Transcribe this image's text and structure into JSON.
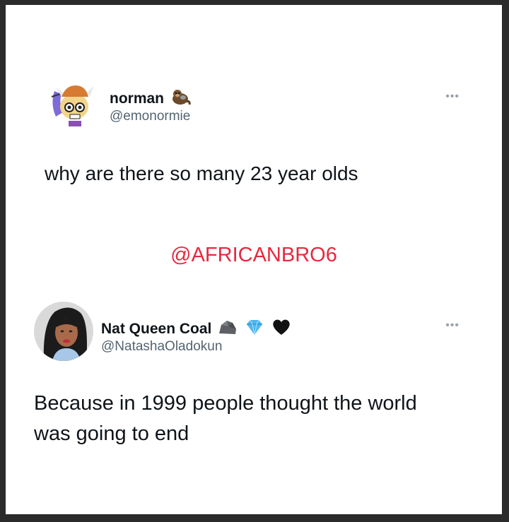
{
  "tweet1": {
    "display_name": "norman",
    "handle": "@emonormie",
    "text": "why are there so many 23 year olds",
    "more": "•••"
  },
  "watermark": "@AFRICANBRO6",
  "tweet2": {
    "display_name": "Nat Queen Coal",
    "handle": "@NatashaOladokun",
    "text": "Because in 1999 people thought the world was going to end",
    "more": "•••"
  },
  "colors": {
    "watermark": "#e5293f",
    "handle": "#536471",
    "text": "#0f1419"
  }
}
